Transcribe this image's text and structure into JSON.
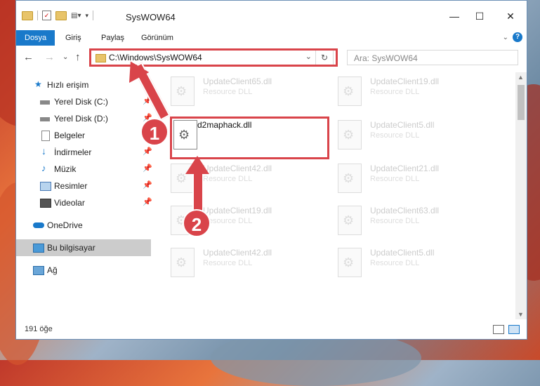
{
  "title": "SysWOW64",
  "ribbon": {
    "tabs": [
      "Dosya",
      "Giriş",
      "Paylaş",
      "Görünüm"
    ]
  },
  "address": {
    "path": "C:\\Windows\\SysWOW64"
  },
  "search": {
    "placeholder": "Ara: SysWOW64"
  },
  "sidebar": {
    "items": [
      {
        "label": "Hızlı erişim",
        "icon": "star-icon"
      },
      {
        "label": "Yerel Disk (C:)",
        "icon": "drive-icon"
      },
      {
        "label": "Yerel Disk (D:)",
        "icon": "drive-icon"
      },
      {
        "label": "Belgeler",
        "icon": "document-icon"
      },
      {
        "label": "İndirmeler",
        "icon": "download-icon"
      },
      {
        "label": "Müzik",
        "icon": "music-icon"
      },
      {
        "label": "Resimler",
        "icon": "pictures-icon"
      },
      {
        "label": "Videolar",
        "icon": "video-icon"
      },
      {
        "label": "OneDrive",
        "icon": "cloud-icon"
      },
      {
        "label": "Bu bilgisayar",
        "icon": "computer-icon"
      },
      {
        "label": "Ağ",
        "icon": "network-icon"
      }
    ]
  },
  "files": [
    {
      "name": "UpdateClient65.dll",
      "type": "Resource DLL"
    },
    {
      "name": "UpdateClient19.dll",
      "type": "Resource DLL"
    },
    {
      "name": "d2maphack.dll",
      "type": ""
    },
    {
      "name": "UpdateClient5.dll",
      "type": "Resource DLL"
    },
    {
      "name": "UpdateClient42.dll",
      "type": "Resource DLL"
    },
    {
      "name": "UpdateClient21.dll",
      "type": "Resource DLL"
    },
    {
      "name": "UpdateClient19.dll",
      "type": "Resource DLL"
    },
    {
      "name": "UpdateClient63.dll",
      "type": "Resource DLL"
    },
    {
      "name": "UpdateClient42.dll",
      "type": "Resource DLL"
    },
    {
      "name": "UpdateClient5.dll",
      "type": "Resource DLL"
    }
  ],
  "status": {
    "count": "191 öğe"
  },
  "annotations": {
    "step1": "1",
    "step2": "2"
  },
  "colors": {
    "accent": "#1979ca",
    "highlight": "#d9444a"
  }
}
